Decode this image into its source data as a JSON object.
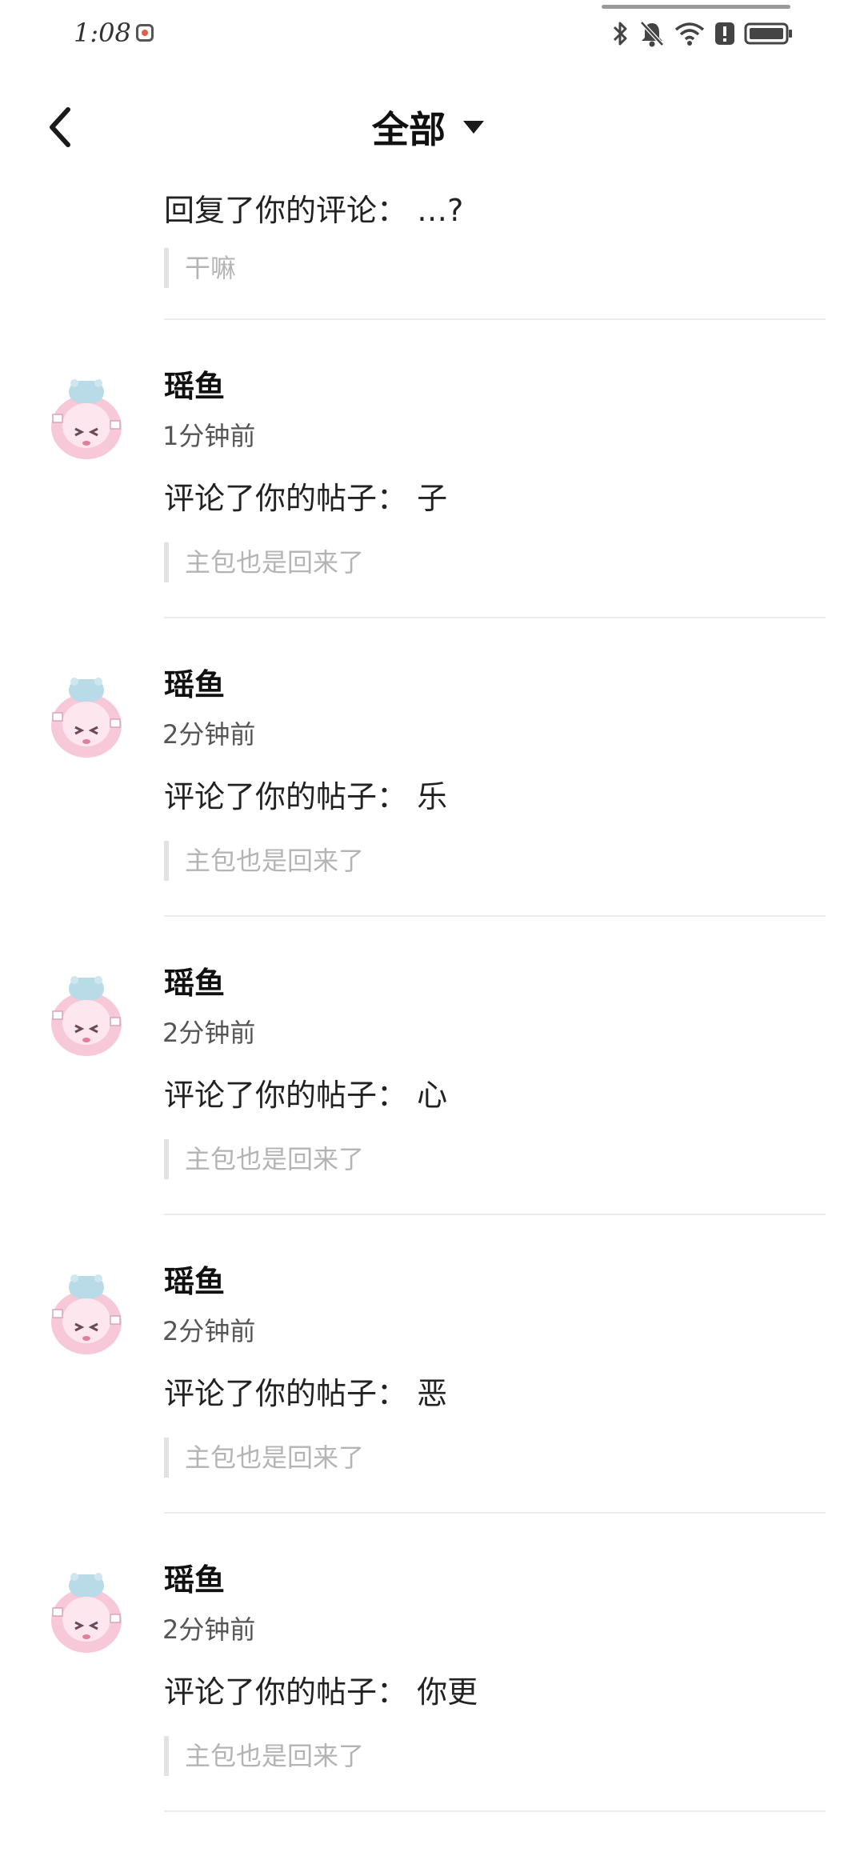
{
  "status_bar": {
    "time": "1:08",
    "icons": [
      "bluetooth-icon",
      "mute-bell-icon",
      "wifi-icon",
      "alert-icon",
      "battery-icon"
    ]
  },
  "header": {
    "back_icon": "chevron-left-icon",
    "title": "全部",
    "dropdown_icon": "caret-down-icon"
  },
  "notifications": [
    {
      "name": "",
      "time": "",
      "action": "回复了你的评论： …?",
      "quote": "干嘛"
    },
    {
      "name": "瑶鱼",
      "time": "1分钟前",
      "action": "评论了你的帖子： 子",
      "quote": "主包也是回来了"
    },
    {
      "name": "瑶鱼",
      "time": "2分钟前",
      "action": "评论了你的帖子： 乐",
      "quote": "主包也是回来了"
    },
    {
      "name": "瑶鱼",
      "time": "2分钟前",
      "action": "评论了你的帖子： 心",
      "quote": "主包也是回来了"
    },
    {
      "name": "瑶鱼",
      "time": "2分钟前",
      "action": "评论了你的帖子： 恶",
      "quote": "主包也是回来了"
    },
    {
      "name": "瑶鱼",
      "time": "2分钟前",
      "action": "评论了你的帖子： 你更",
      "quote": "主包也是回来了"
    }
  ],
  "colors": {
    "avatar_pink": "#f7c9d8",
    "avatar_blue": "#b9dbe8",
    "divider": "#ececec",
    "quote_bar": "#e2e2e2",
    "quote_text": "#b4b4b4"
  }
}
